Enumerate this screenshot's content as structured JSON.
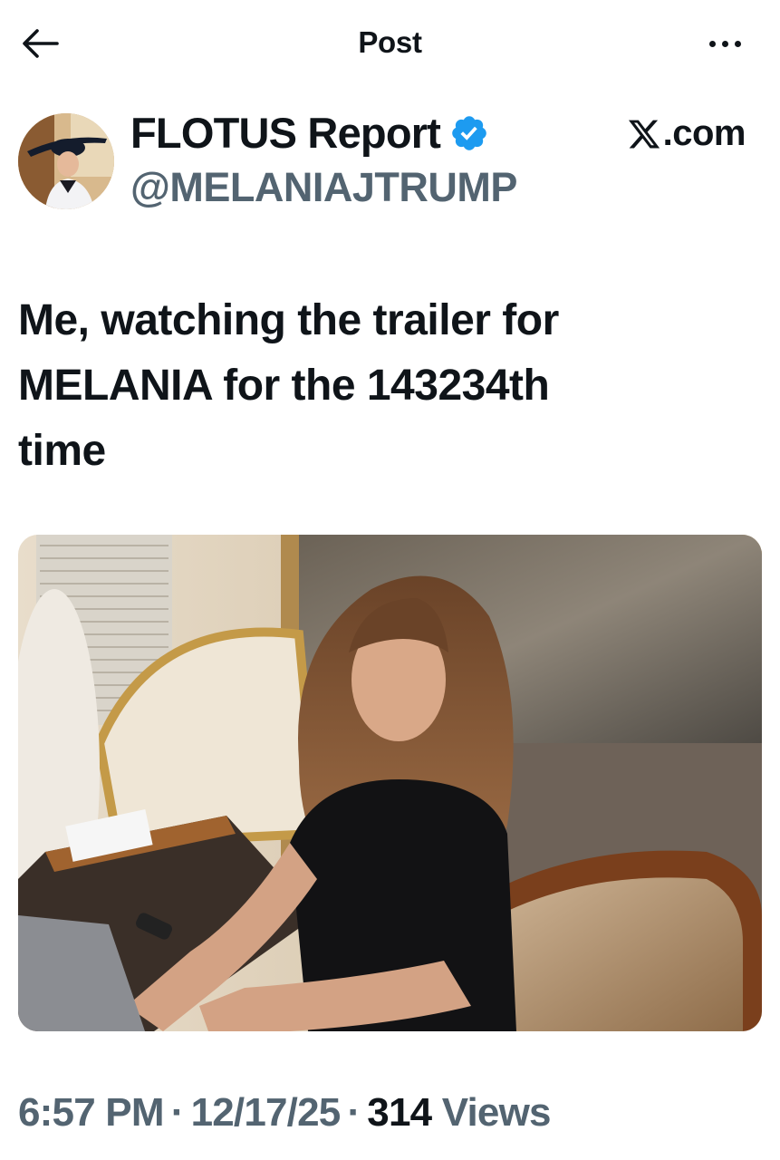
{
  "header": {
    "title": "Post",
    "back_icon": "arrow-left-icon",
    "more_icon": "more-horizontal-icon"
  },
  "author": {
    "name": "FLOTUS Report",
    "handle": "@MELANIAJTRUMP",
    "verified": true,
    "badge_color": "#1d9bf0"
  },
  "source": {
    "logo": "x-logo",
    "domain": ".com"
  },
  "post": {
    "text_line1": "Me, watching the trailer for",
    "text_line2": "MELANIA for the 143234th",
    "text_line3": "time"
  },
  "meta": {
    "time": "6:57 PM",
    "separator": "·",
    "date": "12/17/25",
    "views_count": "314",
    "views_label": "Views"
  },
  "colors": {
    "text_primary": "#0f1419",
    "text_secondary": "#536471",
    "accent": "#1d9bf0"
  }
}
